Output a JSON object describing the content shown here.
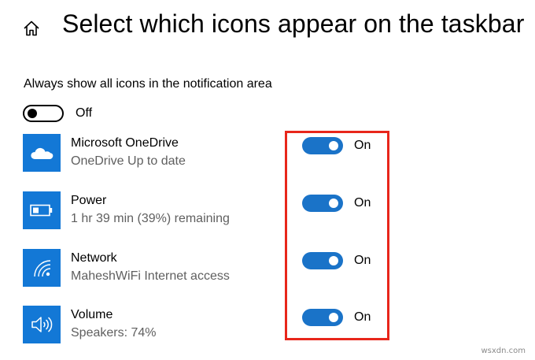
{
  "header": {
    "title": "Select which icons appear on the taskbar",
    "home_icon": "home-icon"
  },
  "always_show": {
    "label": "Always show all icons in the notification area",
    "state": "Off"
  },
  "items": [
    {
      "icon": "cloud-icon",
      "title": "Microsoft OneDrive",
      "subtitle": "OneDrive Up to date",
      "state": "On"
    },
    {
      "icon": "battery-icon",
      "title": "Power",
      "subtitle": "1 hr 39 min (39%) remaining",
      "state": "On"
    },
    {
      "icon": "wifi-icon",
      "title": "Network",
      "subtitle": "MaheshWiFi Internet access",
      "state": "On"
    },
    {
      "icon": "speaker-icon",
      "title": "Volume",
      "subtitle": "Speakers: 74%",
      "state": "On"
    }
  ],
  "colors": {
    "accent": "#1a73c8",
    "tile": "#1378d6",
    "highlight": "#e8261b"
  },
  "watermark": "wsxdn.com"
}
